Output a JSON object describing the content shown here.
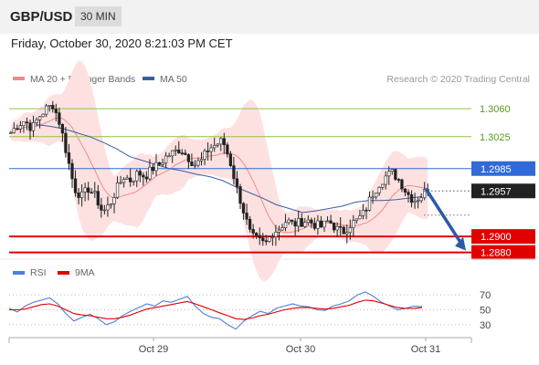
{
  "header": {
    "pair": "GBP/USD",
    "timeframe": "30 MIN"
  },
  "datetime": "Friday, October 30, 2020 8:21:03 PM CET",
  "legend": [
    {
      "label": "MA 20 + Bollinger Bands",
      "color": "#f08a8a"
    },
    {
      "label": "MA 50",
      "color": "#3a5fa0"
    }
  ],
  "credit": "Research © 2020 Trading Central",
  "colors": {
    "resistance": "#8dc63f",
    "pivot": "#2f6ad8",
    "support": "#e00000",
    "bull": "#ffffff",
    "bear": "#222222",
    "bb_fill": "#fde1e1",
    "arrow": "#2a5aa8",
    "rsi": "#4f7fd6",
    "rsi_ma": "#e00000"
  },
  "chart_data": [
    {
      "type": "candlestick",
      "ylim": [
        1.2875,
        1.3075
      ],
      "x_tick_labels": [
        "Oct 29",
        "Oct 30",
        "Oct 31"
      ],
      "levels": [
        {
          "value": 1.306,
          "label": "1.3060",
          "kind": "resistance"
        },
        {
          "value": 1.3025,
          "label": "1.3025",
          "kind": "resistance"
        },
        {
          "value": 1.2985,
          "label": "1.2985",
          "kind": "pivot"
        },
        {
          "value": 1.29,
          "label": "1.2900",
          "kind": "support"
        },
        {
          "value": 1.288,
          "label": "1.2880",
          "kind": "support"
        }
      ],
      "current_price": {
        "value": 1.2957,
        "label": "1.2957"
      },
      "close_path": [
        1.303,
        1.304,
        1.3045,
        1.3035,
        1.305,
        1.306,
        1.3065,
        1.304,
        1.3,
        1.296,
        1.295,
        1.296,
        1.295,
        1.293,
        1.294,
        1.296,
        1.2975,
        1.297,
        1.298,
        1.2975,
        1.2985,
        1.299,
        1.3,
        1.3005,
        1.301,
        1.3,
        1.299,
        1.2995,
        1.301,
        1.3015,
        1.302,
        1.2995,
        1.296,
        1.293,
        1.29,
        1.2895,
        1.289,
        1.2905,
        1.291,
        1.292,
        1.2915,
        1.2918,
        1.292,
        1.2915,
        1.2912,
        1.292,
        1.291,
        1.2905,
        1.2915,
        1.292,
        1.293,
        1.295,
        1.2965,
        1.2975,
        1.298,
        1.297,
        1.2955,
        1.2945,
        1.295,
        1.296
      ],
      "ma50_path": [
        1.304,
        1.3038,
        1.3035,
        1.303,
        1.3025,
        1.3018,
        1.301,
        1.3,
        1.2995,
        1.299,
        1.2985,
        1.2982,
        1.2978,
        1.2975,
        1.297,
        1.2962,
        1.2955,
        1.2948,
        1.294,
        1.2935,
        1.293,
        1.2932,
        1.2935,
        1.2938,
        1.2943,
        1.2945,
        1.2945,
        1.2946,
        1.2948,
        1.295
      ],
      "arrow": {
        "from": 1.296,
        "to": 1.288
      }
    },
    {
      "type": "line",
      "title": "RSI",
      "series": [
        {
          "name": "RSI"
        },
        {
          "name": "9MA"
        }
      ],
      "ylim": [
        20,
        80
      ],
      "y_ticks": [
        {
          "value": 70,
          "label": "70"
        },
        {
          "value": 50,
          "label": "50"
        },
        {
          "value": 30,
          "label": "30"
        }
      ],
      "rsi": [
        52,
        47,
        55,
        60,
        63,
        66,
        58,
        45,
        35,
        40,
        44,
        38,
        30,
        34,
        42,
        48,
        53,
        58,
        55,
        62,
        60,
        64,
        68,
        55,
        45,
        40,
        38,
        30,
        24,
        35,
        42,
        48,
        45,
        52,
        55,
        58,
        55,
        54,
        50,
        49,
        55,
        58,
        62,
        70,
        74,
        68,
        60,
        55,
        50,
        52,
        55,
        54
      ],
      "rsi_ma": [
        50,
        50,
        51,
        54,
        57,
        58,
        55,
        50,
        45,
        43,
        42,
        40,
        38,
        38,
        40,
        43,
        47,
        51,
        53,
        55,
        57,
        59,
        61,
        58,
        54,
        50,
        46,
        42,
        38,
        37,
        39,
        42,
        44,
        47,
        50,
        52,
        53,
        53,
        52,
        51,
        52,
        54,
        56,
        60,
        63,
        62,
        59,
        56,
        53,
        52,
        52,
        53
      ]
    }
  ]
}
